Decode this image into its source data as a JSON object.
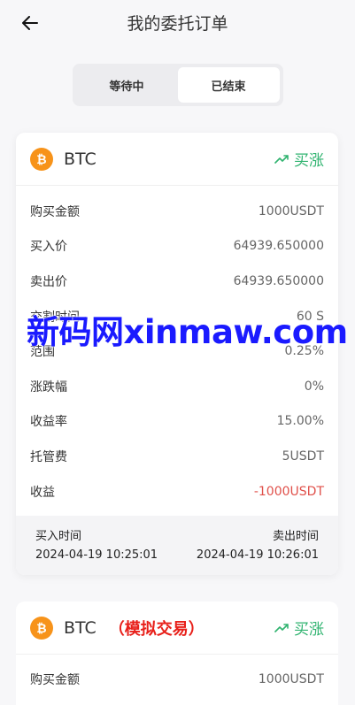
{
  "header": {
    "title": "我的委托订单"
  },
  "tabs": [
    {
      "label": "等待中",
      "active": false
    },
    {
      "label": "已结束",
      "active": true
    }
  ],
  "orders": [
    {
      "coin": "BTC",
      "coin_icon": "bitcoin-icon",
      "coin_color": "#f7931a",
      "direction": "买涨",
      "direction_color": "#2fb36f",
      "rows": [
        {
          "label": "购买金额",
          "value": "1000USDT"
        },
        {
          "label": "买入价",
          "value": "64939.650000"
        },
        {
          "label": "卖出价",
          "value": "64939.650000"
        },
        {
          "label": "交割时间",
          "value": "60 S"
        },
        {
          "label": "范围",
          "value": "0.25%"
        },
        {
          "label": "涨跌幅",
          "value": "0%"
        },
        {
          "label": "收益率",
          "value": "15.00%"
        },
        {
          "label": "托管费",
          "value": "5USDT"
        },
        {
          "label": "收益",
          "value": "-1000USDT"
        }
      ],
      "times": {
        "buy_label": "买入时间",
        "sell_label": "卖出时间",
        "buy_time": "2024-04-19 10:25:01",
        "sell_time": "2024-04-19 10:26:01"
      }
    },
    {
      "coin": "BTC",
      "tag": "（模拟交易）",
      "coin_icon": "bitcoin-icon",
      "direction": "买涨",
      "rows": [
        {
          "label": "购买金额",
          "value": "1000USDT"
        }
      ]
    }
  ],
  "watermark": "新码网xinmaw.com",
  "colors": {
    "positive": "#2fb36f",
    "negative": "#e0504a",
    "simulated": "#e8201a",
    "watermark": "#1a1aff"
  }
}
